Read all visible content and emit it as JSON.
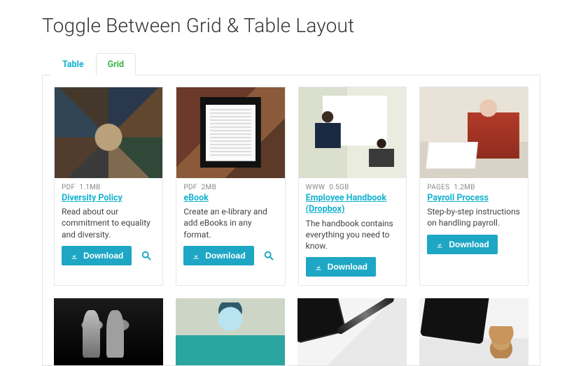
{
  "page_title": "Toggle Between Grid & Table Layout",
  "tabs": {
    "table": "Table",
    "grid": "Grid",
    "active": "grid"
  },
  "download_label": "Download",
  "cards": [
    {
      "filetype": "PDF",
      "size": "1.1MB",
      "title": "Diversity Policy",
      "desc": "Read about our commitment to equality and diversity.",
      "has_preview": true,
      "thumb_class": "th-feet"
    },
    {
      "filetype": "PDF",
      "size": "2MB",
      "title": "eBook",
      "desc": "Create an e-library and add eBooks in any format.",
      "has_preview": true,
      "thumb_class": "th-kindle"
    },
    {
      "filetype": "WWW",
      "size": "0.5GB",
      "title": "Employee Handbook (Dropbox)",
      "desc": "The handbook contains everything you need to know.",
      "has_preview": false,
      "thumb_class": "th-whiteboard"
    },
    {
      "filetype": "PAGES",
      "size": "1.2MB",
      "title": "Payroll Process",
      "desc": "Step-by-step instructions on handling payroll.",
      "has_preview": false,
      "thumb_class": "th-payroll"
    }
  ],
  "cards_row2": [
    {
      "thumb_class": "th-mic"
    },
    {
      "thumb_class": "th-nurse"
    },
    {
      "thumb_class": "th-pen"
    },
    {
      "thumb_class": "th-coins"
    }
  ]
}
